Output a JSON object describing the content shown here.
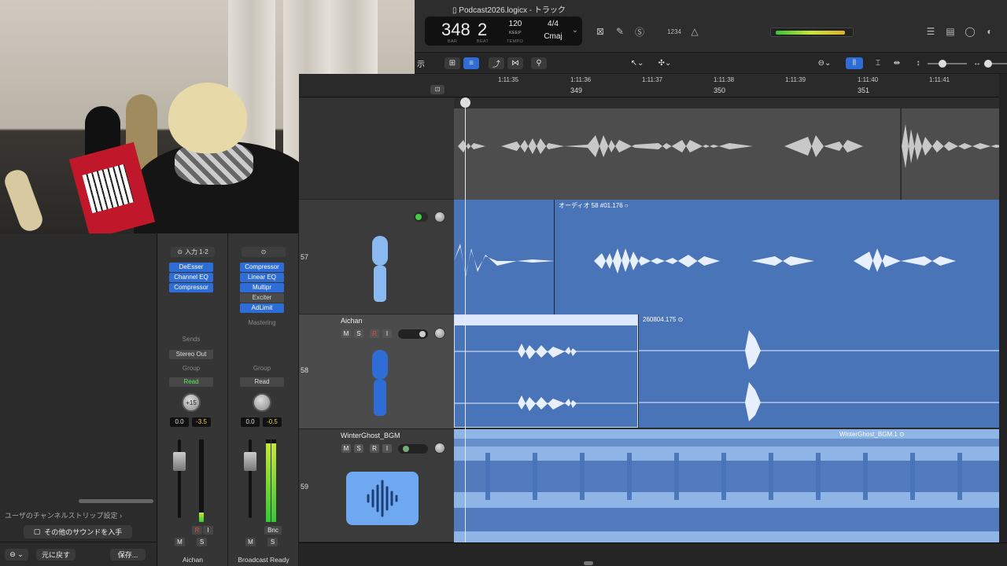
{
  "window": {
    "title": "Podcast2026.logicx - トラック"
  },
  "lcd": {
    "bar": "348",
    "beat": "2",
    "bar_label": "BAR",
    "beat_label": "BEAT",
    "tempo": "120",
    "keep": "KEEP",
    "tempo_label": "TEMPO",
    "signature": "4/4",
    "key": "Cmaj"
  },
  "toolbar": {
    "count_in": "1234",
    "view_label": "示"
  },
  "ruler": {
    "times": [
      "1:11:35",
      "1:11:36",
      "1:11:37",
      "1:11:38",
      "1:11:39",
      "1:11:40",
      "1:11:41"
    ],
    "bars": [
      "349",
      "350",
      "351"
    ]
  },
  "library": {
    "settings_label": "ユーザのチャンネルストリップ設定",
    "more_sounds": "その他のサウンドを入手",
    "undo": "元に戻す",
    "save": "保存..."
  },
  "strips": [
    {
      "name": "Aichan",
      "input": "入力 1-2",
      "plugins": [
        "DeEsser",
        "Channel EQ",
        "Compressor"
      ],
      "sends_label": "Sends",
      "output": "Stereo Out",
      "group": "Group",
      "automation": "Read",
      "pan": "+15",
      "volume": "0.0",
      "peak": "-3.5",
      "record": "R",
      "input_monitor": "I",
      "mute": "M",
      "solo": "S"
    },
    {
      "name": "Broadcast Ready",
      "plugins": [
        "Compressor",
        "Linear EQ",
        "Multipr",
        "Exciter",
        "AdLimit"
      ],
      "mastering_label": "Mastering",
      "group": "Group",
      "automation": "Read",
      "volume": "0.0",
      "peak": "-0.5",
      "bounce": "Bnc",
      "mute": "M",
      "solo": "S"
    }
  ],
  "tracks": [
    {
      "number": "57",
      "name": "",
      "region": "オーディオ 58 #01.176"
    },
    {
      "number": "58",
      "name": "Aichan",
      "region": "260804.175"
    },
    {
      "number": "59",
      "name": "WinterGhost_BGM",
      "region": "WinterGhost_BGM.1"
    }
  ],
  "track_buttons": {
    "mute": "M",
    "solo": "S",
    "record": "R",
    "input": "I"
  },
  "colors": {
    "region_blue": "#4a74b8",
    "bgm_blue": "#8fb4e6",
    "accent": "#2f6dd6"
  }
}
